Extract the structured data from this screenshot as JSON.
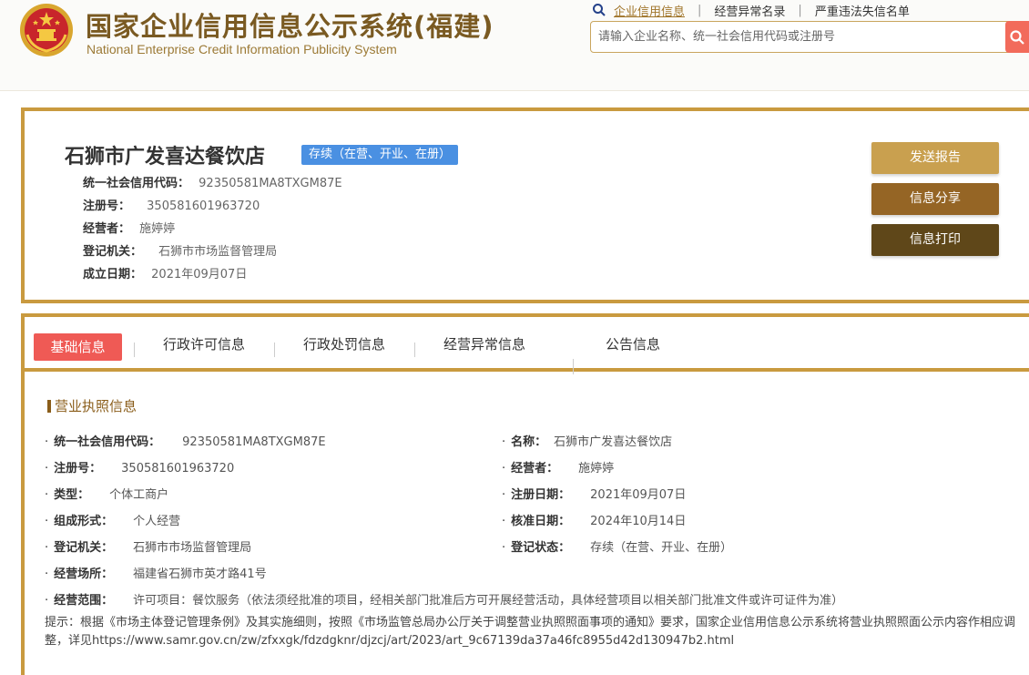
{
  "header": {
    "title_cn": "国家企业信用信息公示系统(福建)",
    "title_en": "National Enterprise Credit Information Publicity System",
    "nav_links": [
      "企业信用信息",
      "经营异常名录",
      "严重违法失信名单"
    ],
    "search_placeholder": "请输入企业名称、统一社会信用代码或注册号",
    "accent_color": "#c99a3f"
  },
  "company": {
    "name": "石狮市广发喜达餐饮店",
    "status": "存续（在营、开业、在册）",
    "rows": [
      {
        "label": "统一社会信用代码：",
        "value": "92350581MA8TXGM87E"
      },
      {
        "label": "注册号：",
        "value": "350581601963720"
      },
      {
        "label": "经营者：",
        "value": "施婷婷"
      },
      {
        "label": "登记机关：",
        "value": "石狮市市场监督管理局"
      },
      {
        "label": "成立日期：",
        "value": "2021年09月07日"
      }
    ],
    "buttons": [
      "发送报告",
      "信息分享",
      "信息打印"
    ]
  },
  "tabs": [
    "基础信息",
    "行政许可信息",
    "行政处罚信息",
    "经营异常信息",
    "公告信息"
  ],
  "license": {
    "section_title": "营业执照信息",
    "left": [
      {
        "label": "统一社会信用代码：",
        "value": "92350581MA8TXGM87E"
      },
      {
        "label": "注册号：",
        "value": "350581601963720"
      },
      {
        "label": "类型：",
        "value": "个体工商户"
      },
      {
        "label": "组成形式：",
        "value": "个人经营"
      },
      {
        "label": "登记机关：",
        "value": "石狮市市场监督管理局"
      },
      {
        "label": "经营场所：",
        "value": "福建省石狮市英才路41号"
      },
      {
        "label": "经营范围：",
        "value": "许可项目：餐饮服务（依法须经批准的项目，经相关部门批准后方可开展经营活动，具体经营项目以相关部门批准文件或许可证件为准）"
      }
    ],
    "right": [
      {
        "label": "名称：",
        "value": "石狮市广发喜达餐饮店"
      },
      {
        "label": "经营者：",
        "value": "施婷婷"
      },
      {
        "label": "注册日期：",
        "value": "2021年09月07日"
      },
      {
        "label": "核准日期：",
        "value": "2024年10月14日"
      },
      {
        "label": "登记状态：",
        "value": "存续（在营、开业、在册）"
      }
    ],
    "notice": "提示：根据《市场主体登记管理条例》及其实施细则，按照《市场监管总局办公厅关于调整营业执照照面事项的通知》要求，国家企业信用信息公示系统将营业执照照面公示内容作相应调整，详见https://www.samr.gov.cn/zw/zfxxgk/fdzdgknr/djzcj/art/2023/art_9c67139da37a46fc8955d42d130947b2.html"
  }
}
